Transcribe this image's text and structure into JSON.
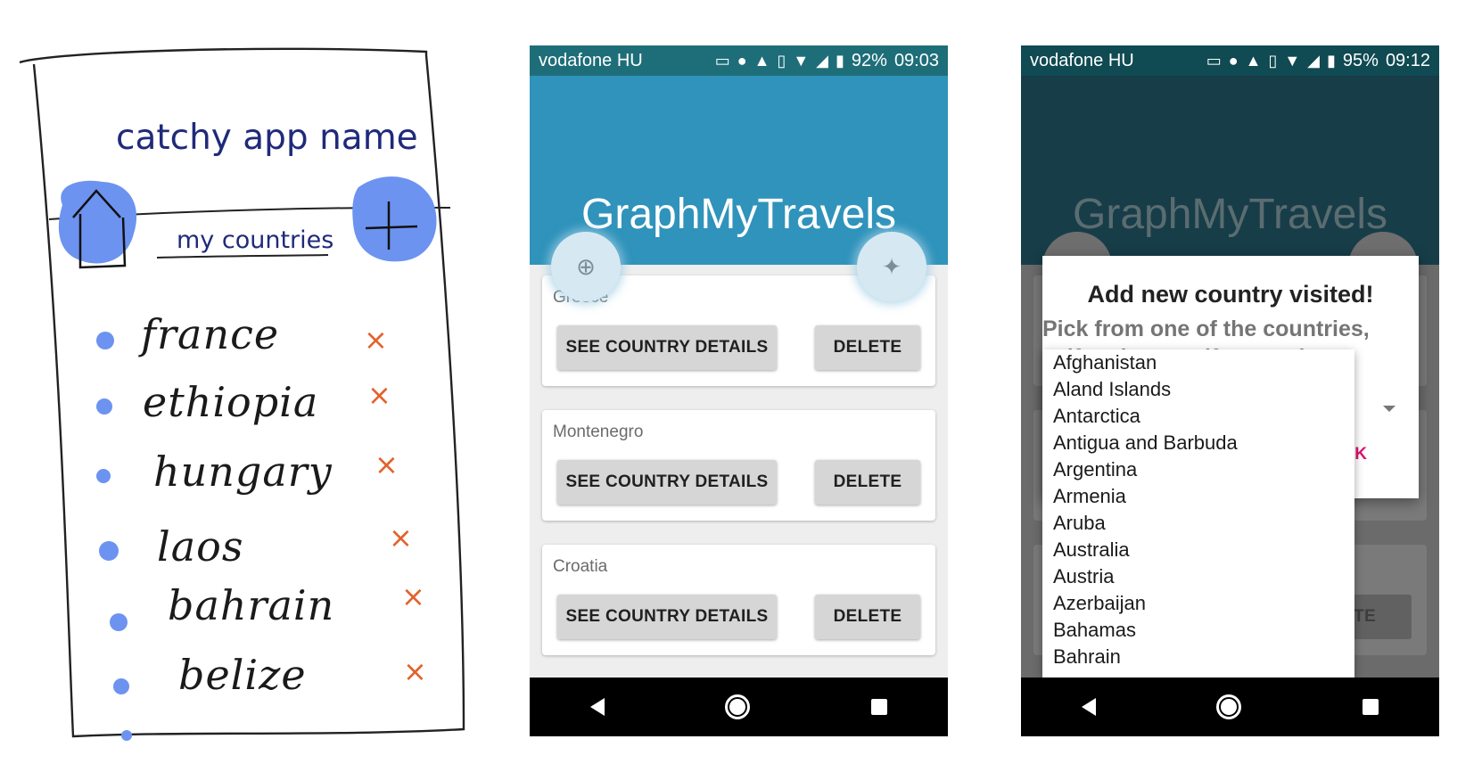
{
  "sketch": {
    "title": "catchy app name",
    "subtitle": "my countries",
    "items": [
      "france",
      "ethiopia",
      "hungary",
      "laos",
      "bahrain",
      "belize"
    ],
    "remove_mark": "×",
    "bullet_color": "#6c93f0",
    "remove_color": "#e2622a",
    "home_icon": "house-icon",
    "add_icon": "plus-icon"
  },
  "phone1": {
    "status": {
      "carrier": "vodafone HU",
      "battery": "92%",
      "time": "09:03"
    },
    "app_title": "GraphMyTravels",
    "fab_left_icon": "globe-icon",
    "fab_right_icon": "compass-icon",
    "cards": [
      {
        "country": "Greece",
        "details_label": "SEE COUNTRY DETAILS",
        "delete_label": "DELETE"
      },
      {
        "country": "Montenegro",
        "details_label": "SEE COUNTRY DETAILS",
        "delete_label": "DELETE"
      },
      {
        "country": "Croatia",
        "details_label": "SEE COUNTRY DETAILS",
        "delete_label": "DELETE"
      }
    ]
  },
  "phone2": {
    "status": {
      "carrier": "vodafone HU",
      "battery": "95%",
      "time": "09:12"
    },
    "app_title": "GraphMyTravels",
    "background_delete_label": "ETE",
    "dialog": {
      "title": "Add new country visited!",
      "message_line1": "Pick from one of the countries,",
      "message_line2": "self    and non  self  governing",
      "ok_label": "OK"
    },
    "dropdown_options": [
      "Afghanistan",
      "Aland Islands",
      "Antarctica",
      "Antigua and Barbuda",
      "Argentina",
      "Armenia",
      "Aruba",
      "Australia",
      "Austria",
      "Azerbaijan",
      "Bahamas",
      "Bahrain"
    ]
  },
  "colors": {
    "teal_status": "#1e6e79",
    "appbar_blue": "#2f93bb",
    "ok_pink": "#e0126c"
  }
}
